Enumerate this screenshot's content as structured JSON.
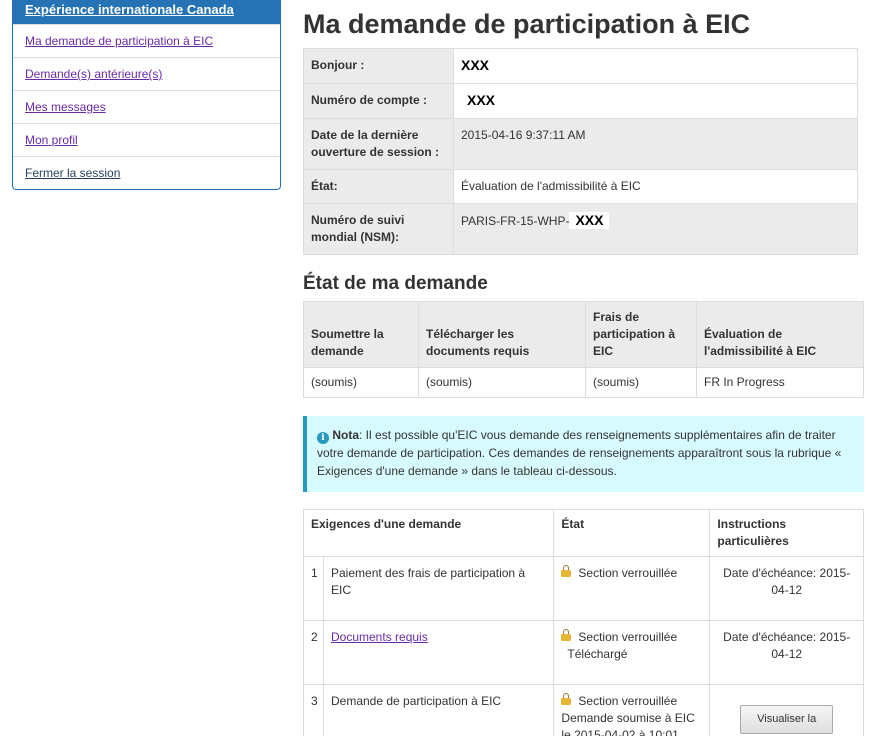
{
  "sidebar": {
    "header": "Expérience internationale Canada",
    "items": [
      {
        "label": "Ma demande de participation à EIC"
      },
      {
        "label": "Demande(s) antérieure(s)"
      },
      {
        "label": "Mes messages"
      },
      {
        "label": "Mon profil"
      },
      {
        "label": "Fermer la session"
      }
    ]
  },
  "main": {
    "title": "Ma demande de participation à EIC",
    "info": [
      {
        "label": "Bonjour :",
        "value": "XXX"
      },
      {
        "label": "Numéro de compte :",
        "value": "XXX"
      },
      {
        "label": "Date de la dernière ouverture de session :",
        "value": "2015-04-16 9:37:11 AM"
      },
      {
        "label": "État:",
        "value": "Évaluation de l'admissibilité à EIC"
      },
      {
        "label": "Numéro de suivi mondial (NSM):",
        "value_prefix": "PARIS-FR-15-WHP-",
        "value": "XXX"
      }
    ],
    "status_title": "État de ma demande",
    "status_headers": [
      "Soumettre la demande",
      "Télécharger les documents requis",
      "Frais de participation à EIC",
      "Évaluation de l'admissibilité à EIC"
    ],
    "status_values": [
      "(soumis)",
      "(soumis)",
      "(soumis)",
      "FR In Progress"
    ],
    "note": {
      "label": "Nota",
      "icon": "info-icon",
      "text": ": Il est possible qu'EIC vous demande des renseignements supplémentaires afin de traiter votre demande de participation. Ces demandes de renseignements apparaîtront sous la rubrique « Exigences d'une demande » dans le tableau ci-dessous."
    },
    "requirements": {
      "headers": [
        "Exigences d'une demande",
        "État",
        "Instructions particulières"
      ],
      "rows": [
        {
          "num": "1",
          "name": "Paiement des frais de participation à EIC",
          "state": "Section verrouillée",
          "state2": "",
          "instr": "Date d'échéance: 2015-04-12"
        },
        {
          "num": "2",
          "name": "Documents requis",
          "state": "Section verrouillée",
          "state2": "Téléchargé",
          "instr": "Date d'échéance: 2015-04-12"
        },
        {
          "num": "3",
          "name": "Demande de participation à EIC",
          "state": "Section verrouillée",
          "state2": "Demande soumise à EIC le 2015-04-02 à 10:01",
          "button": "Visualiser la"
        }
      ]
    }
  }
}
